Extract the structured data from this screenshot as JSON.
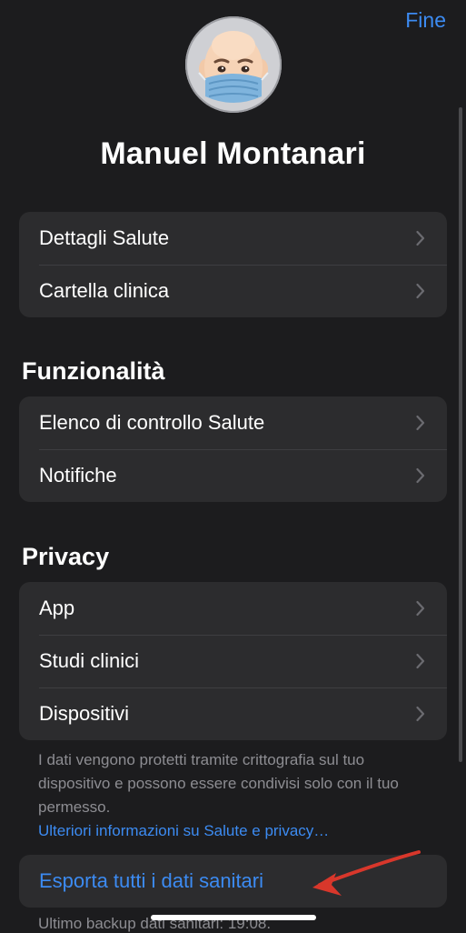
{
  "header": {
    "done_label": "Fine"
  },
  "profile": {
    "name": "Manuel Montanari"
  },
  "group_main": {
    "items": [
      {
        "label": "Dettagli Salute"
      },
      {
        "label": "Cartella clinica"
      }
    ]
  },
  "features": {
    "title": "Funzionalità",
    "items": [
      {
        "label": "Elenco di controllo Salute"
      },
      {
        "label": "Notifiche"
      }
    ]
  },
  "privacy": {
    "title": "Privacy",
    "items": [
      {
        "label": "App"
      },
      {
        "label": "Studi clinici"
      },
      {
        "label": "Dispositivi"
      }
    ],
    "footnote": "I dati vengono protetti tramite crittografia sul tuo dispositivo e possono essere condivisi solo con il tuo permesso.",
    "footnote_link": "Ulteriori informazioni su Salute e privacy…"
  },
  "export": {
    "label": "Esporta tutti i dati sanitari",
    "backup_text": "Ultimo backup dati sanitari: 19:08."
  },
  "colors": {
    "background": "#1c1c1e",
    "cell": "#2c2c2e",
    "accent_blue": "#3c8bf2",
    "secondary_text": "#8d8d92",
    "annotation_red": "#d8372b"
  },
  "icons": {
    "chevron": "chevron-right-icon",
    "avatar": "memoji-avatar-with-mask"
  }
}
